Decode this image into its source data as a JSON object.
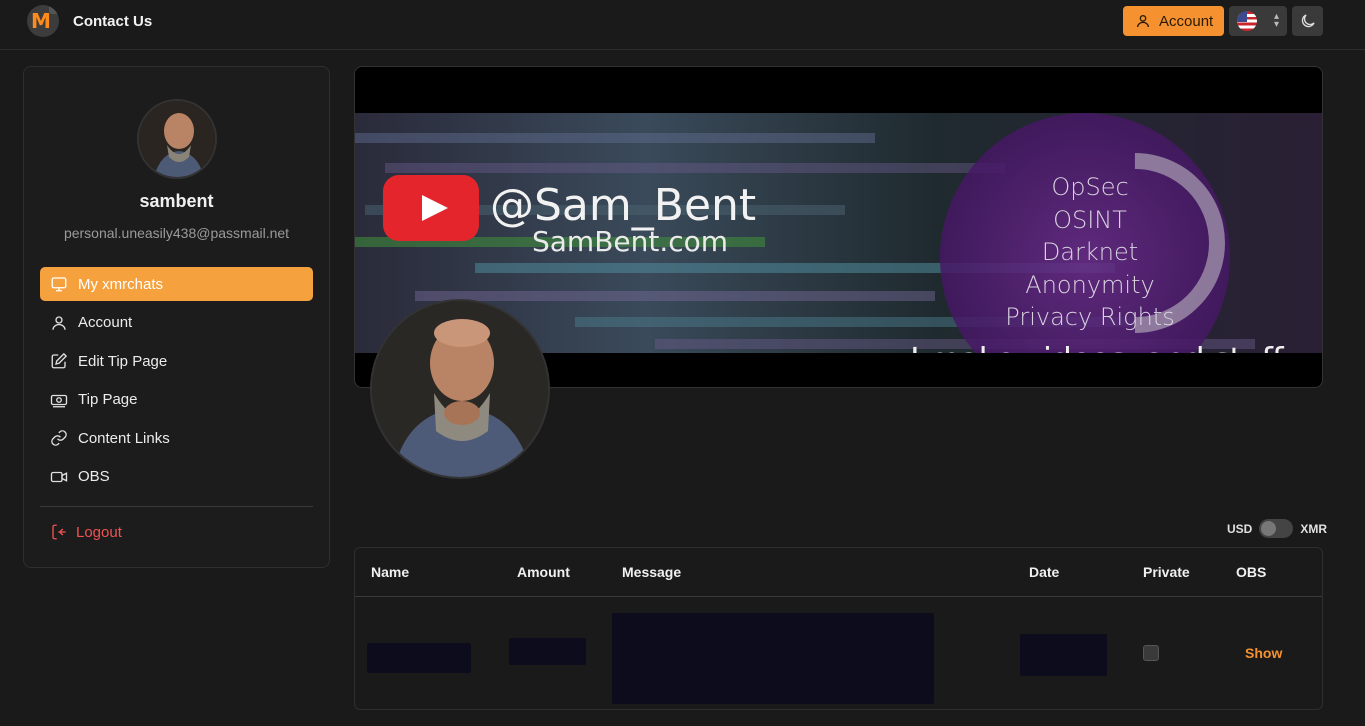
{
  "header": {
    "brand": "Contact Us",
    "account_label": "Account",
    "colors": {
      "accent": "#f5922f"
    }
  },
  "sidebar": {
    "username": "sambent",
    "email": "personal.uneasily438@passmail.net",
    "items": [
      {
        "label": "My xmrchats",
        "icon": "monitor-icon",
        "active": true
      },
      {
        "label": "Account",
        "icon": "user-icon"
      },
      {
        "label": "Edit Tip Page",
        "icon": "edit-icon"
      },
      {
        "label": "Tip Page",
        "icon": "cash-icon"
      },
      {
        "label": "Content Links",
        "icon": "link-icon"
      },
      {
        "label": "OBS",
        "icon": "video-icon"
      }
    ],
    "logout_label": "Logout"
  },
  "banner": {
    "handle": "@Sam_Bent",
    "site": "SamBent.com",
    "tags": [
      "OpSec",
      "OSINT",
      "Darknet",
      "Anonymity",
      "Privacy Rights"
    ],
    "tagline": "I make videos, and stuff."
  },
  "currency_toggle": {
    "left": "USD",
    "right": "XMR"
  },
  "table": {
    "columns": [
      "Name",
      "Amount",
      "Message",
      "Date",
      "Private",
      "OBS"
    ],
    "row_action": "Show"
  }
}
